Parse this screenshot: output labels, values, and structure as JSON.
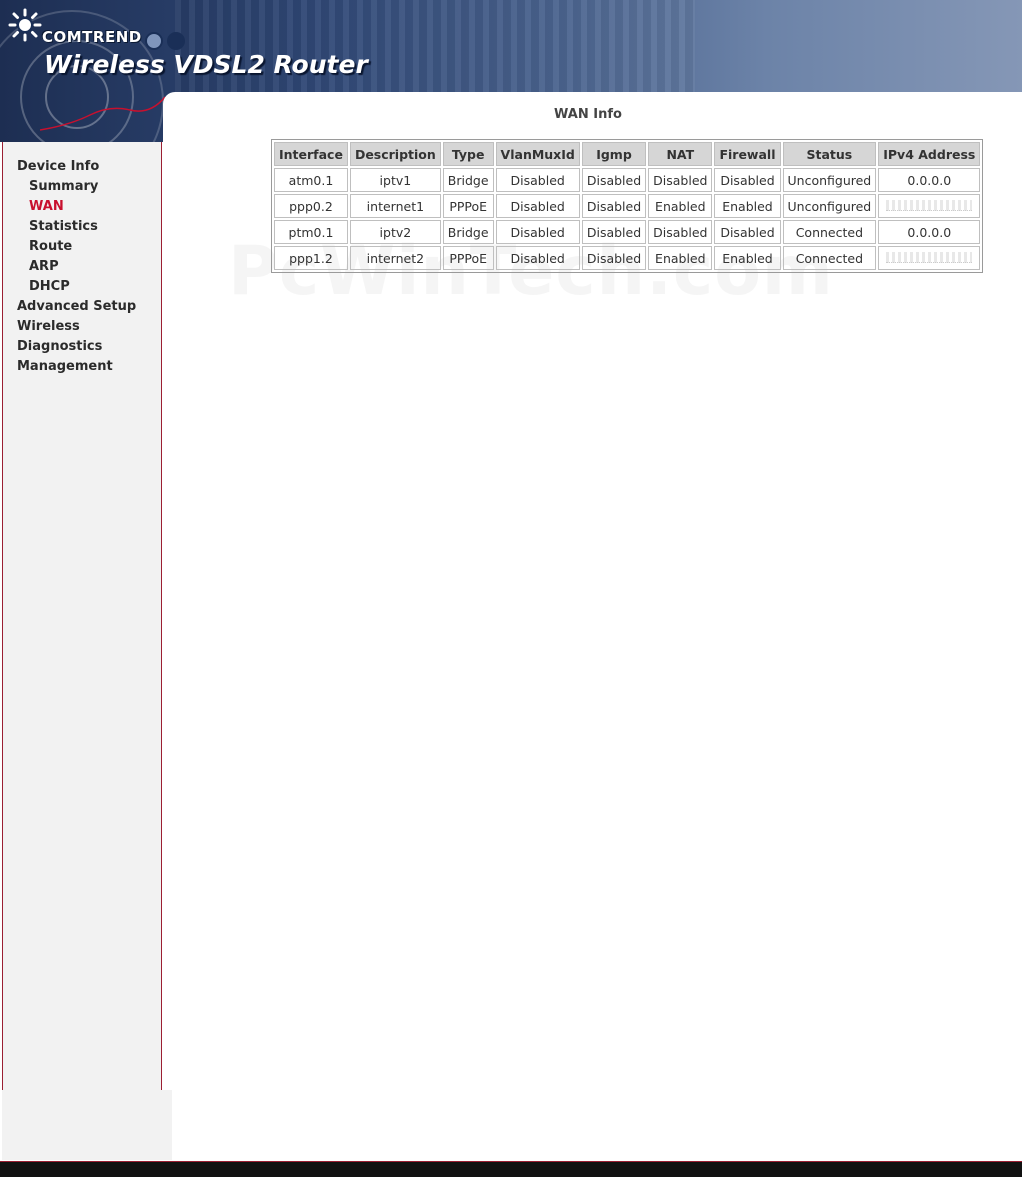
{
  "header": {
    "brand": "COMTREND",
    "product": "Wireless VDSL2 Router"
  },
  "sidebar": {
    "items": [
      {
        "label": "Device Info",
        "level": 0
      },
      {
        "label": "Summary",
        "level": 1
      },
      {
        "label": "WAN",
        "level": 1,
        "active": true
      },
      {
        "label": "Statistics",
        "level": 1
      },
      {
        "label": "Route",
        "level": 1
      },
      {
        "label": "ARP",
        "level": 1
      },
      {
        "label": "DHCP",
        "level": 1
      },
      {
        "label": "Advanced Setup",
        "level": 0
      },
      {
        "label": "Wireless",
        "level": 0
      },
      {
        "label": "Diagnostics",
        "level": 0
      },
      {
        "label": "Management",
        "level": 0
      }
    ]
  },
  "main": {
    "title": "WAN Info",
    "watermark": "PcWinTech.com",
    "table": {
      "headers": [
        "Interface",
        "Description",
        "Type",
        "VlanMuxId",
        "Igmp",
        "NAT",
        "Firewall",
        "Status",
        "IPv4 Address"
      ],
      "rows": [
        [
          "atm0.1",
          "iptv1",
          "Bridge",
          "Disabled",
          "Disabled",
          "Disabled",
          "Disabled",
          "Unconfigured",
          "0.0.0.0"
        ],
        [
          "ppp0.2",
          "internet1",
          "PPPoE",
          "Disabled",
          "Disabled",
          "Enabled",
          "Enabled",
          "Unconfigured",
          ""
        ],
        [
          "ptm0.1",
          "iptv2",
          "Bridge",
          "Disabled",
          "Disabled",
          "Disabled",
          "Disabled",
          "Connected",
          "0.0.0.0"
        ],
        [
          "ppp1.2",
          "internet2",
          "PPPoE",
          "Disabled",
          "Disabled",
          "Enabled",
          "Enabled",
          "Connected",
          ""
        ]
      ]
    }
  },
  "colors": {
    "accent_red": "#c8102e",
    "header_blue": "#2f4775",
    "sidebar_bg": "#f2f2f2"
  }
}
